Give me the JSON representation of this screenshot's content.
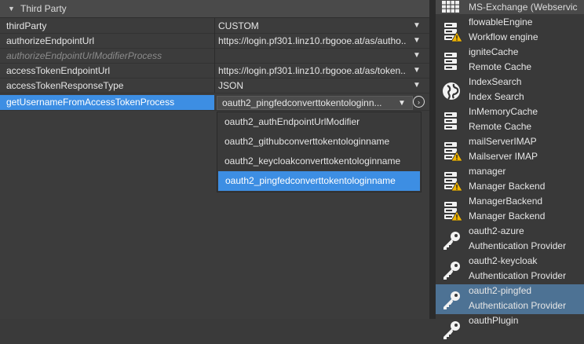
{
  "section": {
    "title": "Third Party"
  },
  "properties": [
    {
      "key": "thirdParty",
      "value": "CUSTOM",
      "has_dropdown": true
    },
    {
      "key": "authorizeEndpointUrl",
      "value": "https://login.pf301.linz10.rbgooe.at/as/autho...",
      "has_dropdown": true
    },
    {
      "key": "authorizeEndpointUrlModifierProcess",
      "value": "",
      "has_dropdown": true
    },
    {
      "key": "accessTokenEndpointUrl",
      "value": "https://login.pf301.linz10.rbgooe.at/as/token...",
      "has_dropdown": true
    },
    {
      "key": "accessTokenResponseType",
      "value": "JSON",
      "has_dropdown": true
    },
    {
      "key": "getUsernameFromAccessTokenProcess",
      "value": "oauth2_pingfedconverttokentologinn...",
      "has_dropdown": true
    }
  ],
  "dropdown": {
    "options": [
      "oauth2_authEndpointUrlModifier",
      "oauth2_githubconverttokentologinname",
      "oauth2_keycloakconverttokentologinname",
      "oauth2_pingfedconverttokentologinname"
    ],
    "selected_index": 3
  },
  "resources": {
    "top_item": {
      "label": "MS-Exchange (Webservic",
      "icon": "grid-icon"
    },
    "items": [
      {
        "name": "flowableEngine",
        "type": "Workflow engine",
        "icon": "server-warning-icon"
      },
      {
        "name": "igniteCache",
        "type": "Remote Cache",
        "icon": "server-icon"
      },
      {
        "name": "IndexSearch",
        "type": "Index Search",
        "icon": "globe-icon"
      },
      {
        "name": "InMemoryCache",
        "type": "Remote Cache",
        "icon": "server-icon"
      },
      {
        "name": "mailServerIMAP",
        "type": "Mailserver IMAP",
        "icon": "server-warning-icon"
      },
      {
        "name": "manager",
        "type": "Manager Backend",
        "icon": "server-warning-icon"
      },
      {
        "name": "ManagerBackend",
        "type": "Manager Backend",
        "icon": "server-warning-icon"
      },
      {
        "name": "oauth2-azure",
        "type": "Authentication Provider",
        "icon": "key-icon"
      },
      {
        "name": "oauth2-keycloak",
        "type": "Authentication Provider",
        "icon": "key-icon"
      },
      {
        "name": "oauth2-pingfed",
        "type": "Authentication Provider",
        "icon": "key-icon",
        "selected": true
      },
      {
        "name": "oauthPlugin",
        "type": "",
        "icon": "key-icon"
      }
    ]
  },
  "colors": {
    "selection": "#3d8ee3",
    "list_selection": "#4d7294",
    "warning": "#f0b400"
  }
}
